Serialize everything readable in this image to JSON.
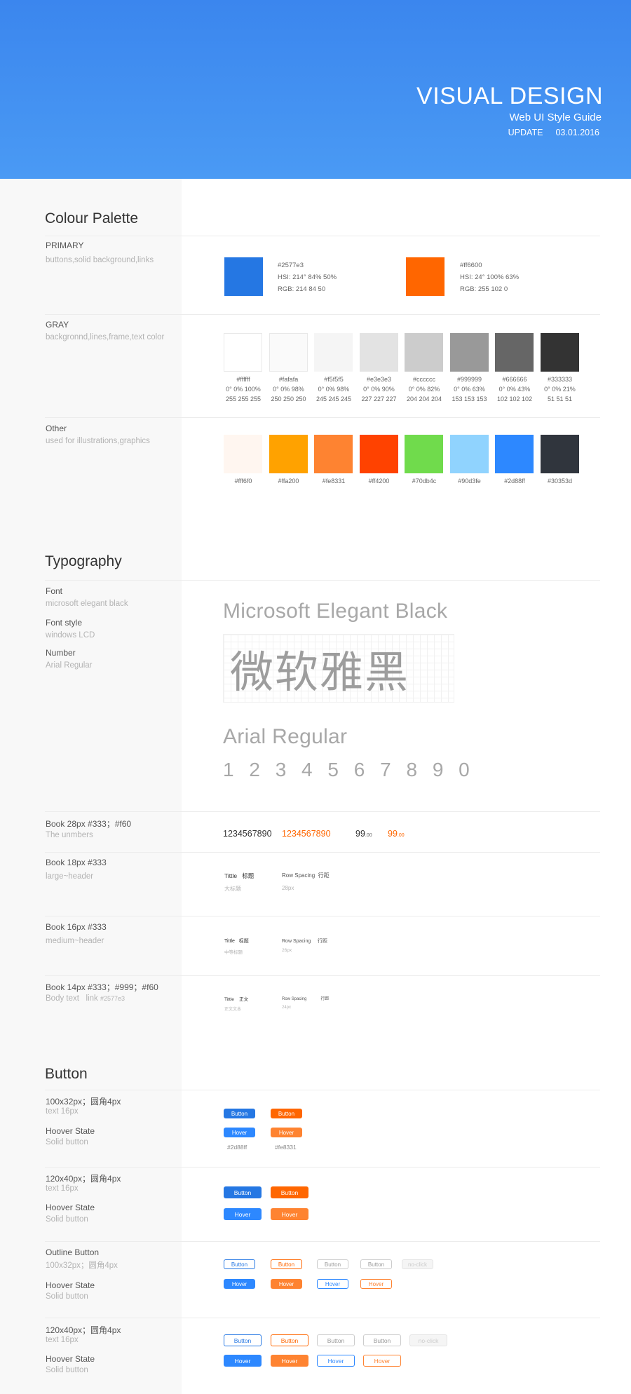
{
  "header": {
    "title": "VISUAL DESIGN",
    "subtitle": "Web UI Style Guide",
    "update_label": "UPDATE",
    "update_date": "03.01.2016"
  },
  "palette": {
    "title": "Colour Palette",
    "primary": {
      "label": "PRIMARY",
      "desc": "buttons,solid background,links",
      "colors": [
        {
          "hex": "#2577e3",
          "lines": [
            "#2577e3",
            "HSI: 214° 84% 50%",
            "RGB: 214 84 50"
          ]
        },
        {
          "hex": "#ff6600",
          "lines": [
            "#ff6600",
            "HSI: 24° 100% 63%",
            "RGB: 255 102 0"
          ]
        }
      ]
    },
    "gray": {
      "label": "GRAY",
      "desc": "backgronnd,lines,frame,text color",
      "colors": [
        {
          "hex": "#ffffff",
          "hsi": "0° 0% 100%",
          "rgb": "255 255 255"
        },
        {
          "hex": "#fafafa",
          "hsi": "0° 0% 98%",
          "rgb": "250 250 250"
        },
        {
          "hex": "#f5f5f5",
          "hsi": "0° 0% 98%",
          "rgb": "245 245 245"
        },
        {
          "hex": "#e3e3e3",
          "hsi": "0° 0% 90%",
          "rgb": "227 227 227"
        },
        {
          "hex": "#cccccc",
          "hsi": "0° 0% 82%",
          "rgb": "204 204 204"
        },
        {
          "hex": "#999999",
          "hsi": "0° 0% 63%",
          "rgb": "153 153 153"
        },
        {
          "hex": "#666666",
          "hsi": "0° 0% 43%",
          "rgb": "102 102 102"
        },
        {
          "hex": "#333333",
          "hsi": "0° 0% 21%",
          "rgb": "51   51   51"
        }
      ]
    },
    "other": {
      "label": "Other",
      "desc": "used for illustrations,graphics",
      "colors": [
        "#fff6f0",
        "#ffa200",
        "#fe8331",
        "#ff4200",
        "#70db4c",
        "#90d3fe",
        "#2d88ff",
        "#30353d"
      ]
    }
  },
  "typography": {
    "title": "Typography",
    "font_label": "Font",
    "font_value": "microsoft elegant black",
    "style_label": "Font style",
    "style_value": "windows LCD",
    "number_label": "Number",
    "number_value": "Arial Regular",
    "sample_font": "Microsoft Elegant Black",
    "sample_cjk": "微软雅黑",
    "sample_arial": "Arial Regular",
    "sample_digits": "1 2 3 4 5 6 7 8 9 0",
    "rows": [
      {
        "label": "Book 28px #333；#f60",
        "desc": "The unmbers",
        "samples": [
          "1234567890",
          "1234567890",
          "99",
          ".00",
          "99",
          ".00"
        ]
      },
      {
        "label": "Book 18px #333",
        "desc": "large~header",
        "samples": [
          "Tittle",
          "标题",
          "大标题",
          "Row Spacing",
          "行距",
          "28px"
        ]
      },
      {
        "label": "Book 16px #333",
        "desc": "medium~header",
        "samples": [
          "Tittle",
          "标题",
          "中等标题",
          "Row Spacing",
          "行距",
          "26px"
        ]
      },
      {
        "label": "Book 14px #333；#999；#f60",
        "desc": "Body text",
        "desc_link": "link",
        "desc_hex": "#2577e3",
        "samples": [
          "Tittle",
          "正文",
          "正文文本",
          "Row Spacing",
          "行距",
          "24px"
        ]
      }
    ]
  },
  "buttons": {
    "title": "Button",
    "groups": [
      {
        "label": "100x32px；圆角4px",
        "sub": "text 16px",
        "hover_label": "Hoover State",
        "hover_sub": "Solid button",
        "hex1": "#2d88ff",
        "hex2": "#fe8331"
      },
      {
        "label": "120x40px；圆角4px",
        "sub": "text 16px",
        "hover_label": "Hoover State",
        "hover_sub": "Solid button"
      },
      {
        "label": "Outline Button",
        "sub": "100x32px；圆角4px",
        "hover_label": "Hoover State",
        "hover_sub": "Solid button"
      },
      {
        "label": "120x40px；圆角4px",
        "sub": "text 16px",
        "hover_label": "Hoover State",
        "hover_sub": "Solid button"
      }
    ],
    "button_label": "Button",
    "hover_label": "Hover",
    "noclick_label": "no-click"
  }
}
